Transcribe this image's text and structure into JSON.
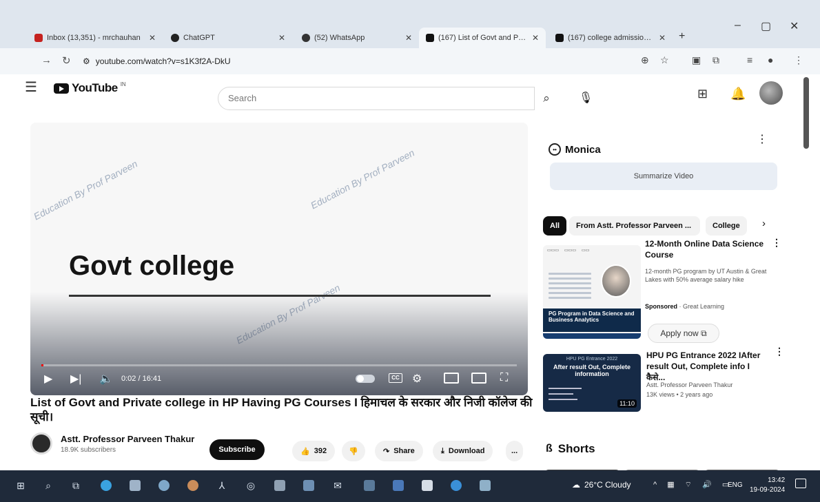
{
  "browser": {
    "tabs": [
      {
        "label": "Inbox (13,351) - mrchauhan",
        "active": false
      },
      {
        "label": "ChatGPT",
        "active": false
      },
      {
        "label": "(52) WhatsApp",
        "active": false
      },
      {
        "label": "(167) List of Govt and Priva",
        "active": true
      },
      {
        "label": "(167) college admission pr",
        "active": false
      }
    ],
    "url": "youtube.com/watch?v=s1K3f2A-DkU"
  },
  "youtube": {
    "logo_text": "YouTube",
    "logo_sup": "IN",
    "search_placeholder": "Search"
  },
  "player": {
    "slide_title": "Govt college",
    "watermark": "Education By Prof Parveen",
    "time": "0:02 / 16:41",
    "progress_fraction": 0.002,
    "cc_label": "CC"
  },
  "video": {
    "title": "List of Govt and Private college in HP Having PG Courses I हिमाचल के सरकार और निजी कॉलेज की सूची।",
    "channel": "Astt. Professor Parveen Thakur",
    "subscribers": "18.9K subscribers",
    "subscribe_label": "Subscribe",
    "likes": "392",
    "share_label": "Share",
    "download_label": "Download",
    "more_label": "..."
  },
  "sidebar": {
    "monica": {
      "title": "Monica",
      "summarize_label": "Summarize Video"
    },
    "chips": [
      "All",
      "From Astt. Professor Parveen ...",
      "College"
    ],
    "ad": {
      "title": "12-Month Online Data Science Course",
      "description": "12-month PG program by UT Austin & Great Lakes with 50% average salary hike",
      "sponsored_label": "Sponsored",
      "sponsor": "Great Learning",
      "apply_label": "Apply now",
      "thumb_band": "PG Program in Data Science and Business Analytics"
    },
    "video2": {
      "title": "HPU PG Entrance 2022 IAfter result Out, Complete info I कैसे...",
      "channel": "Astt. Professor Parveen Thakur",
      "meta": "13K views • 2 years ago",
      "duration": "11:10",
      "thumb_head": "HPU PG Entrance 2022",
      "thumb_main": "After result Out, Complete information"
    },
    "shorts_label": "Shorts"
  },
  "taskbar": {
    "weather": "26°C Cloudy",
    "language": "ENG",
    "time": "13:42",
    "date": "19-09-2024"
  }
}
